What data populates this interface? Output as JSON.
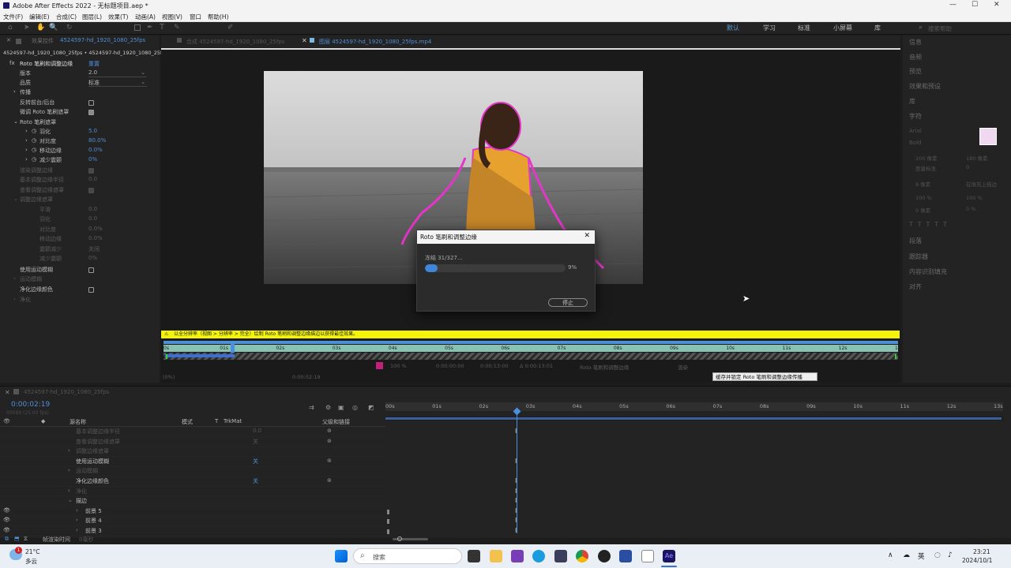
{
  "window": {
    "title": "Adobe After Effects 2022 - 无标题项目.aep *",
    "minimize": "—",
    "maximize": "☐",
    "close": "✕"
  },
  "menu": [
    "文件(F)",
    "编辑(E)",
    "合成(C)",
    "图层(L)",
    "效果(T)",
    "动画(A)",
    "视图(V)",
    "窗口",
    "帮助(H)"
  ],
  "workspaces": [
    "默认",
    "学习",
    "标准",
    "小屏幕",
    "库"
  ],
  "search_help": "搜索帮助",
  "left_panel": {
    "tab": "效果控件",
    "tab_file": "4524597-hd_1920_1080_25fps",
    "breadcrumb": "4524597-hd_1920_1080_25fps • 4524597-hd_1920_1080_25fp...",
    "effect_name": "Roto 笔刷和调整边缘",
    "reset": "重置",
    "version_label": "版本",
    "version_value": "2.0",
    "quality_label": "品质",
    "quality_value": "标准",
    "propagation": "传播",
    "invert": "反转前台/后台",
    "fine_tune": "微调 Roto 笔刷遮罩",
    "matte_group": "Roto 笔刷遮罩",
    "feather": "羽化",
    "feather_val": "5.0",
    "contrast": "对比度",
    "contrast_val": "80.0%",
    "shift_edge": "移动边缘",
    "shift_edge_val": "0.0%",
    "reduce_chatter": "减少震颤",
    "reduce_chatter_val": "0%",
    "dim_rows": [
      "渲染调整边缘",
      "基本调整边缘半径",
      "查看调整边缘遮罩",
      "调整边缘遮罩",
      "平滑",
      "羽化",
      "对比度",
      "移动边缘",
      "震颤减少",
      "减少震颤"
    ],
    "dim_vals": [
      "0.0",
      "0.0",
      "0.0",
      "0.0%",
      "0.0%",
      "关闭",
      "0%"
    ],
    "use_motion_blur": "使用运动模糊",
    "motion_blur": "运动模糊",
    "decontaminate": "净化边缘颜色",
    "decontam_group": "净化"
  },
  "viewer": {
    "tab1": "合成 4524597-hd_1920_1080_25fps",
    "tab2": "图层 4524597-hd_1920_1080_25fps.mp4",
    "warning": "以全分辨率（视图 > 分辨率 > 完全）绘制 Roto 笔刷和调整边缘描边以获得最佳效果。",
    "ruler_ticks": [
      "0s",
      "01s",
      "02s",
      "03s",
      "04s",
      "05s",
      "06s",
      "07s",
      "08s",
      "09s",
      "10s",
      "11s",
      "12s",
      "13s"
    ],
    "ctrl_zoom": "100 %",
    "ctrl_t1": "0:00:00:00",
    "ctrl_t2": "0:00:13:00",
    "ctrl_t3": "Δ 0:00:13:01",
    "ctrl_effect": "Roto 笔刷和调整边缘",
    "ctrl_render": "渲染",
    "zoom2": "(0%)",
    "time2": "0:00:02:19",
    "tooltip": "缓存并锁定 Roto 笔刷和调整边缘传播"
  },
  "dialog": {
    "title": "Roto 笔刷和调整边缘",
    "status": "冻结 31/327...",
    "percent": "9%",
    "progress": 0.09,
    "stop": "停止"
  },
  "right_panel": [
    "信息",
    "音频",
    "预览",
    "效果和预设",
    "库",
    "字符",
    "段落",
    "跟踪器",
    "内容识别填充",
    "对齐"
  ],
  "right_char": {
    "font": "Arial",
    "style": "Bold",
    "size": "200 像素",
    "leading": "180 像素",
    "kerning": "度量标准",
    "track": "0",
    "stroke": "8 像素",
    "stroke_mode": "在填充上描边",
    "vscale": "100 %",
    "hscale": "100 %",
    "baseline": "0 像素",
    "tsume": "0 %"
  },
  "timeline": {
    "comp": "4524597-hd_1920_1080_25fps",
    "timecode": "0:00:02:19",
    "fps": "00069 (25.00 fps)",
    "cols": [
      "源名称",
      "模式",
      "T",
      "TrkMat",
      "父级和链接"
    ],
    "rows": [
      {
        "name": "基本调整边缘半径",
        "val": "0.0",
        "dim": true
      },
      {
        "name": "查看调整边缘遮罩",
        "val": "关",
        "dim": true
      },
      {
        "name": "调整边缘遮罩",
        "val": "",
        "dim": true
      },
      {
        "name": "使用运动模糊",
        "val": "关",
        "dim": false
      },
      {
        "name": "运动模糊",
        "val": "",
        "dim": true
      },
      {
        "name": "净化边缘颜色",
        "val": "关",
        "dim": false
      },
      {
        "name": "净化",
        "val": "",
        "dim": true
      },
      {
        "name": "描边",
        "val": "",
        "dim": false
      },
      {
        "name": "前景 5",
        "val": "",
        "dim": false
      },
      {
        "name": "前景 4",
        "val": "",
        "dim": false
      },
      {
        "name": "前景 3",
        "val": "",
        "dim": false
      }
    ],
    "ruler": [
      "00s",
      "01s",
      "02s",
      "03s",
      "04s",
      "05s",
      "06s",
      "07s",
      "08s",
      "09s",
      "10s",
      "11s",
      "12s",
      "13s"
    ],
    "footer": "帧渲染时间",
    "footer_val": "0毫秒"
  },
  "taskbar": {
    "weather_temp": "21°C",
    "weather_desc": "多云",
    "badge": "1",
    "search": "搜索",
    "lang": "英",
    "time": "23:21",
    "date": "2024/10/1"
  }
}
